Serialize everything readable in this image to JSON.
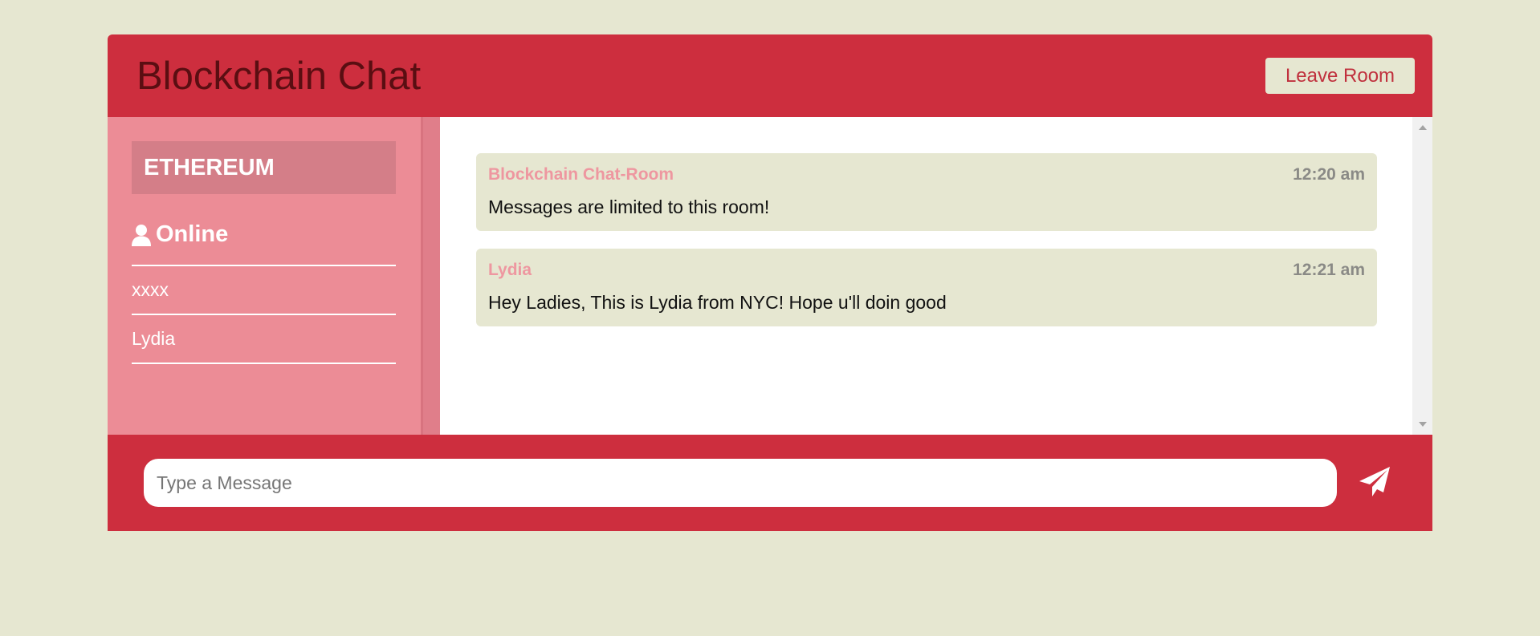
{
  "header": {
    "title": "Blockchain Chat",
    "leave_label": "Leave Room"
  },
  "sidebar": {
    "room_name": "ETHEREUM",
    "online_label": "Online",
    "users": [
      "xxxx",
      "Lydia"
    ]
  },
  "messages": [
    {
      "author": "Blockchain Chat-Room",
      "time": "12:20 am",
      "text": "Messages are limited to this room!"
    },
    {
      "author": "Lydia",
      "time": "12:21 am",
      "text": "Hey Ladies, This is Lydia from NYC! Hope u'll doin good"
    }
  ],
  "composer": {
    "placeholder": "Type a Message",
    "send_icon": "paper-plane-icon"
  },
  "colors": {
    "primary": "#cd2e3e",
    "sidebar": "#ec8c96",
    "background": "#e6e7d1"
  }
}
